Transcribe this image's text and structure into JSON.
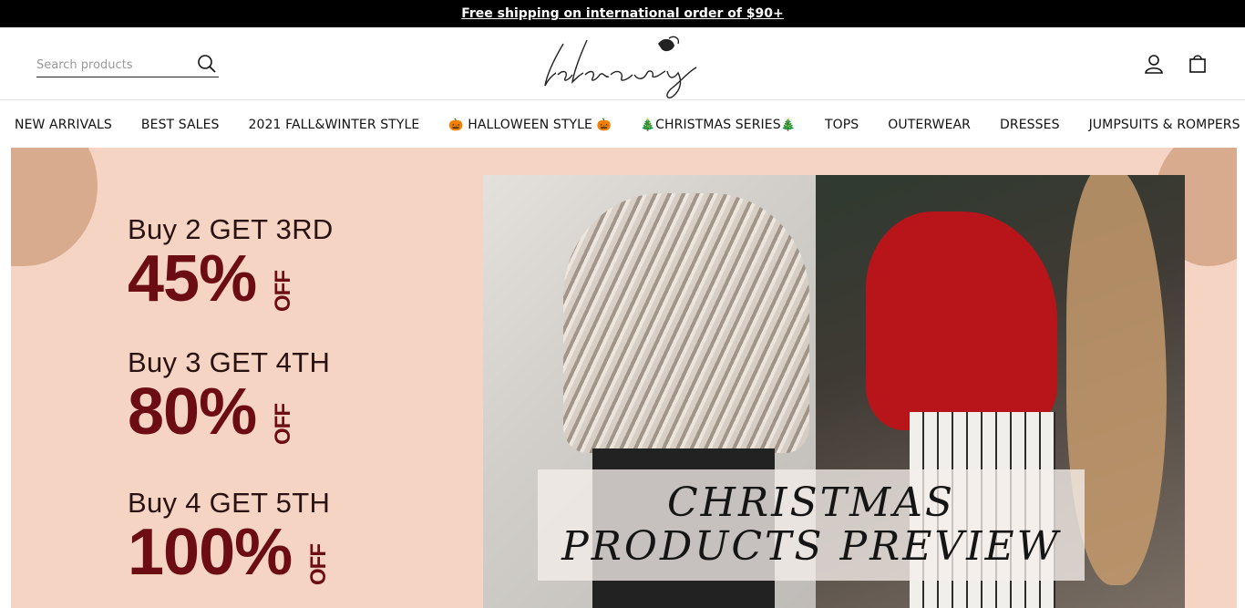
{
  "announcement": {
    "text": "Free shipping on international order of $90+"
  },
  "header": {
    "search": {
      "placeholder": "Search products"
    },
    "logo_text": "lalarosy",
    "icons": {
      "search": "search-icon",
      "account": "account-icon",
      "cart": "cart-icon"
    }
  },
  "nav": {
    "items": [
      {
        "label": "NEW ARRIVALS"
      },
      {
        "label": "BEST SALES"
      },
      {
        "label": "2021 FALL&WINTER STYLE"
      },
      {
        "label": "HALLOWEEN STYLE",
        "emoji_before": "🎃",
        "emoji_after": "🎃"
      },
      {
        "label": "CHRISTMAS SERIES",
        "emoji_before": "🎄",
        "emoji_after": "🎄"
      },
      {
        "label": "TOPS"
      },
      {
        "label": "OUTERWEAR"
      },
      {
        "label": "DRESSES"
      },
      {
        "label": "JUMPSUITS & ROMPERS"
      }
    ]
  },
  "hero": {
    "offers": [
      {
        "line": "Buy 2 GET 3RD",
        "percent": "45%",
        "suffix": "OFF"
      },
      {
        "line": "Buy 3 GET 4TH",
        "percent": "80%",
        "suffix": "OFF"
      },
      {
        "line": "Buy 4 GET 5TH",
        "percent": "100%",
        "suffix": "OFF"
      }
    ],
    "caption_line1": "CHRISTMAS",
    "caption_line2": "PRODUCTS PREVIEW",
    "colors": {
      "background": "#f6d4c4",
      "accent": "#6b0d12",
      "blob": "#d8ab8f"
    }
  }
}
